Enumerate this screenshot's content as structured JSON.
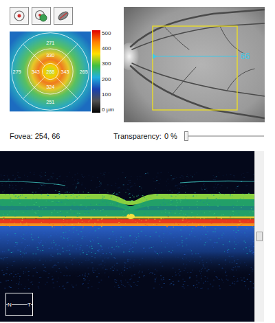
{
  "toolbar": [
    {
      "kind": "target"
    },
    {
      "kind": "overlay"
    },
    {
      "kind": "scan"
    }
  ],
  "thickness_map": {
    "outer": {
      "top": "271",
      "left": "279",
      "right": "265",
      "bottom": "251"
    },
    "inner": {
      "top": "330",
      "left": "343",
      "right": "343",
      "bottom": "324"
    },
    "center": "288"
  },
  "color_scale": [
    "500",
    "400",
    "300",
    "200",
    "100",
    "0 µm"
  ],
  "fundus": {
    "scan_label": "66"
  },
  "fovea": "Fovea: 254, 66",
  "transparency": {
    "label": "Transparency:",
    "value": "0 %",
    "level": 0
  },
  "bscan": {
    "orientation": [
      "N",
      "T"
    ]
  },
  "scrollbar": {
    "level": 0.5
  }
}
